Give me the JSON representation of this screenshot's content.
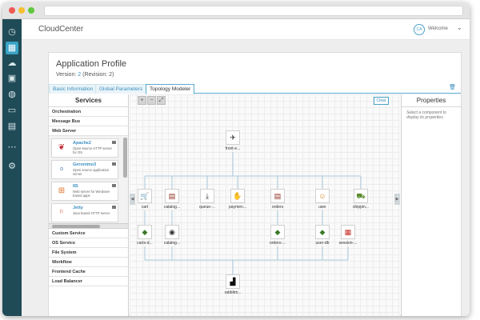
{
  "app": {
    "brand": "CloudCenter",
    "user_initials": "CA",
    "welcome": "Welcome",
    "welcome_caret": "⌄"
  },
  "window": {
    "traffic_lights": [
      "#ee5b54",
      "#f6be2f",
      "#5fc83e"
    ]
  },
  "leftnav": {
    "icons": [
      {
        "name": "dashboard-icon",
        "glyph": "◷"
      },
      {
        "name": "apps-grid-icon",
        "glyph": "▦"
      },
      {
        "name": "deploy-cloud-icon",
        "glyph": "☁"
      },
      {
        "name": "jobs-briefcase-icon",
        "glyph": "▣"
      },
      {
        "name": "environments-globe-icon",
        "glyph": "◍"
      },
      {
        "name": "folder-icon",
        "glyph": "▭"
      },
      {
        "name": "reports-icon",
        "glyph": "▤"
      },
      {
        "name": "more-icon",
        "glyph": "⋯"
      },
      {
        "name": "settings-gear-icon",
        "glyph": "⚙"
      }
    ]
  },
  "profile": {
    "title": "Application Profile",
    "version_label": "Version:",
    "version_value": "2",
    "revision": "(Revision: 2)"
  },
  "tabs": [
    {
      "label": "Basic Information"
    },
    {
      "label": "Global Parameters"
    },
    {
      "label": "Topology Modeler",
      "active": true
    }
  ],
  "services": {
    "title": "Services",
    "top_categories": [
      "Orchestration",
      "Message Bus",
      "Web Server"
    ],
    "items": [
      {
        "name": "Apache2",
        "desc": "Open-source HTTP server for OS"
      },
      {
        "name": "Geronimo3",
        "desc": "Open source application server"
      },
      {
        "name": "IIS",
        "desc": "Web server for Windows-based apps"
      },
      {
        "name": "Jetty",
        "desc": "Java based HTTP server"
      }
    ],
    "bottom_categories": [
      "Custom Service",
      "OS Service",
      "File System",
      "Workflow",
      "Frontend Cache",
      "Load Balancer"
    ]
  },
  "canvas": {
    "clear_label": "Clear",
    "zoom_in": "+",
    "zoom_out": "−",
    "fit": "⤢",
    "nodes": [
      {
        "id": "front",
        "label": "front-e..."
      },
      {
        "id": "cart",
        "label": "cart"
      },
      {
        "id": "catalog",
        "label": "catalog..."
      },
      {
        "id": "queue",
        "label": "queue-..."
      },
      {
        "id": "payment",
        "label": "paymen..."
      },
      {
        "id": "orders",
        "label": "orders"
      },
      {
        "id": "user",
        "label": "user"
      },
      {
        "id": "shipping",
        "label": "shippin..."
      },
      {
        "id": "cartsdb",
        "label": "carts-d..."
      },
      {
        "id": "catalogdb",
        "label": "catalog..."
      },
      {
        "id": "ordersdb",
        "label": "orders-..."
      },
      {
        "id": "userdb",
        "label": "user-db"
      },
      {
        "id": "sessiondb",
        "label": "session-..."
      },
      {
        "id": "rabbit",
        "label": "rabbitm..."
      }
    ]
  },
  "properties": {
    "title": "Properties",
    "hint": "Select a component to display its properties."
  }
}
